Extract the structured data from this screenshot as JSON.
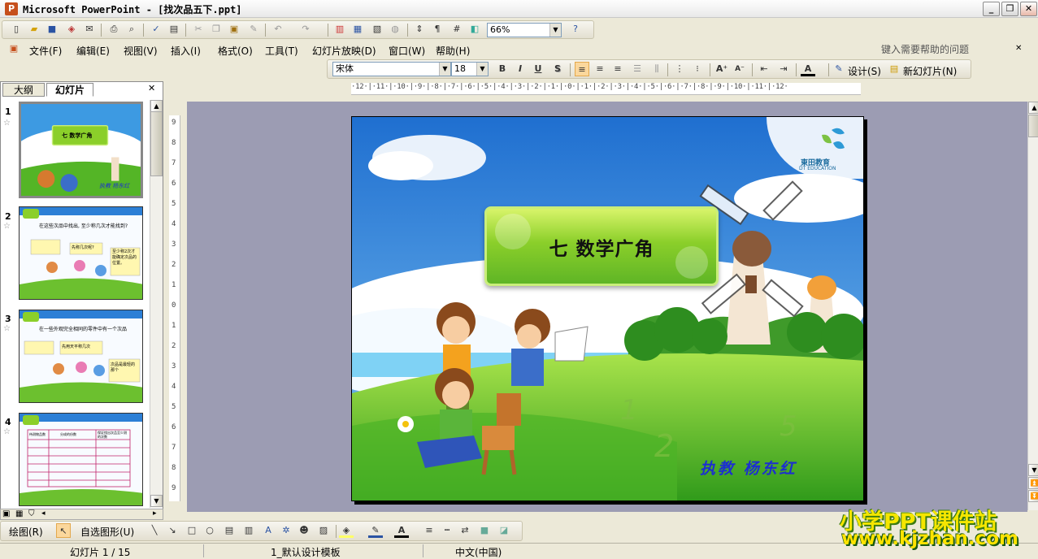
{
  "window": {
    "title": "Microsoft PowerPoint - [找次品五下.ppt]",
    "app_icon": "P",
    "controls": [
      "_",
      "❐",
      "✕"
    ]
  },
  "toolbar_standard": {
    "zoom": "66%",
    "icons": [
      "new-icon",
      "open-icon",
      "save-icon",
      "permission-icon",
      "email-icon",
      "print-icon",
      "print-preview-icon",
      "spelling-icon",
      "research-icon",
      "cut-icon",
      "copy-icon",
      "paste-icon",
      "format-painter-icon",
      "undo-icon",
      "redo-icon",
      "insert-chart-icon",
      "insert-table-icon",
      "tables-borders-icon",
      "hyperlink-icon",
      "expand-icon",
      "show-formatting-icon",
      "grid-icon",
      "color-icon",
      "help-icon"
    ]
  },
  "menu": {
    "items": [
      "文件(F)",
      "编辑(E)",
      "视图(V)",
      "插入(I)",
      "格式(O)",
      "工具(T)",
      "幻灯片放映(D)",
      "窗口(W)",
      "帮助(H)"
    ],
    "help_placeholder": "键入需要帮助的问题",
    "doc_close": "✕"
  },
  "toolbar_format": {
    "font": "宋体",
    "size": "18",
    "bold": "B",
    "italic": "I",
    "underline": "U",
    "shadow": "S",
    "design_label": "设计(S)",
    "new_slide_label": "新幻灯片(N)"
  },
  "left_pane": {
    "tabs": [
      "大纲",
      "幻灯片"
    ],
    "close": "✕",
    "thumbs": [
      {
        "num": "1",
        "title": "七 数学广角",
        "author": "执教 杨东红"
      },
      {
        "num": "2",
        "text_a": "在这些次品中找出, 至少称几次才能找到?",
        "text_b": "先称几次呢?",
        "text_c": "至少称2次才能确定次品的位置。"
      },
      {
        "num": "3",
        "text_a": "在一些外观完全相同的零件中有一个次品",
        "text_b": "先用天平称几次",
        "text_c": "次品是最轻的那个"
      },
      {
        "num": "4",
        "text_a": "待测物品数",
        "text_b": "分成的份数",
        "text_c": "保证找出次品至少测的次数"
      }
    ]
  },
  "rulers": {
    "horizontal": "·12·|·11·|·10·|·9·|·8·|·7·|·6·|·5·|·4·|·3·|·2·|·1·|·0·|·1·|·2·|·3·|·4·|·5·|·6·|·7·|·8·|·9·|·10·|·11·|·12·",
    "vertical": [
      "9",
      "8",
      "7",
      "6",
      "5",
      "4",
      "3",
      "2",
      "1",
      "0",
      "1",
      "2",
      "3",
      "4",
      "5",
      "6",
      "7",
      "8",
      "9"
    ]
  },
  "slide": {
    "title": "七   数学广角",
    "author": "执教   杨东红",
    "logo_name": "東田教育",
    "logo_sub": "DT EDUCATION",
    "deco_numbers": [
      "1",
      "2",
      "5"
    ]
  },
  "drawing_toolbar": {
    "draw_label": "绘图(R)",
    "autoshapes_label": "自选图形(U)"
  },
  "status": {
    "slide": "幻灯片 1 / 15",
    "template": "1_默认设计模板",
    "language": "中文(中国)"
  },
  "watermark": {
    "line1": "小学PPT课件站",
    "line2": "www.kjzhan.com"
  },
  "colors": {
    "title_box": "#8bcf2a",
    "author_text": "#1c2fd0",
    "canvas_bg": "#9c9cb3",
    "watermark": "#f5e600"
  }
}
